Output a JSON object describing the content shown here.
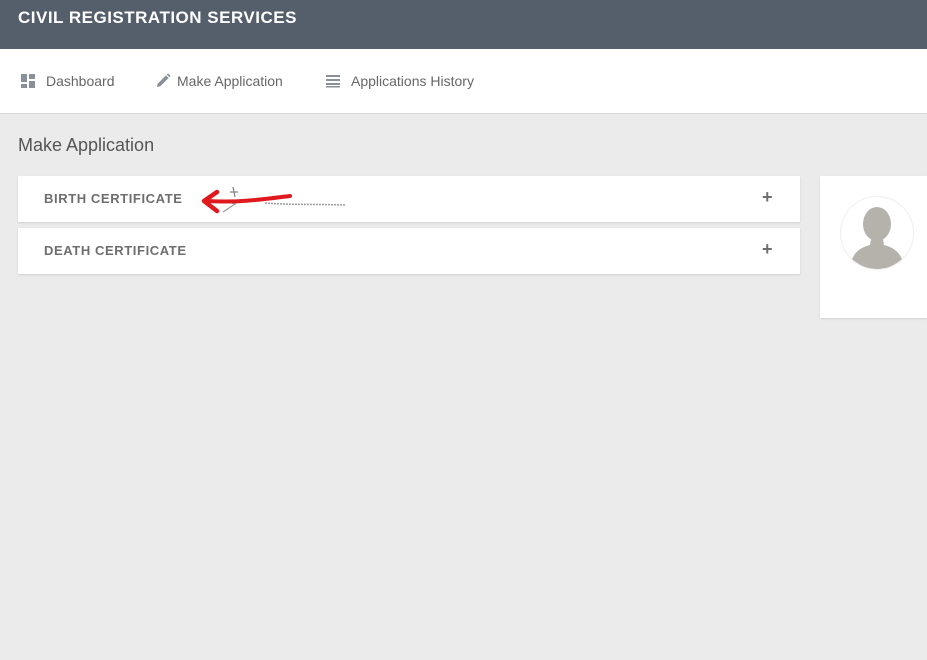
{
  "app": {
    "title": "CIVIL REGISTRATION SERVICES"
  },
  "nav": {
    "items": [
      {
        "label": "Dashboard",
        "icon": "dashboard-icon"
      },
      {
        "label": "Make Application",
        "icon": "pencil-icon"
      },
      {
        "label": "Applications History",
        "icon": "list-icon"
      }
    ]
  },
  "main": {
    "title": "Make Application",
    "panels": [
      {
        "label": "BIRTH CERTIFICATE",
        "expand_symbol": "+"
      },
      {
        "label": "DEATH CERTIFICATE",
        "expand_symbol": "+"
      }
    ]
  },
  "profile": {
    "avatar_icon": "user-silhouette-icon"
  },
  "colors": {
    "topbar": "#555f6b",
    "background": "#ebebeb",
    "annotation_arrow": "#e0191e"
  }
}
